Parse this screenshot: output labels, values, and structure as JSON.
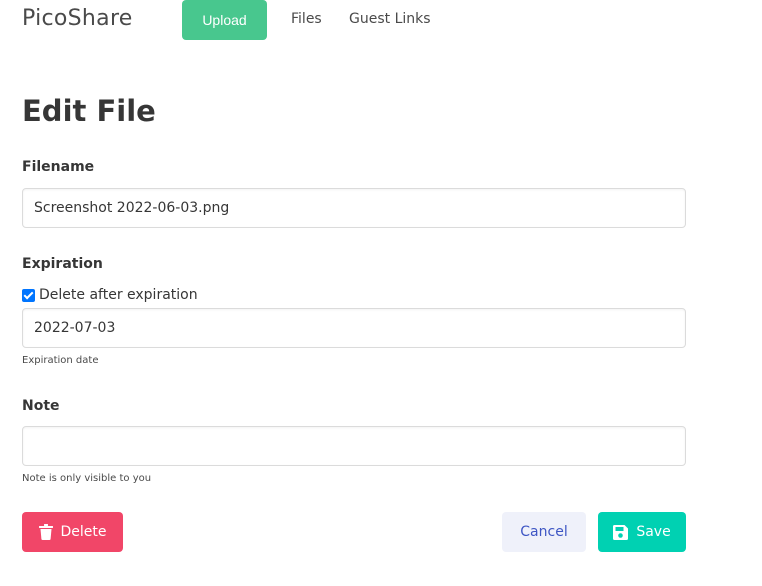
{
  "navbar": {
    "brand": "PicoShare",
    "upload_label": "Upload",
    "files_label": "Files",
    "guest_links_label": "Guest Links"
  },
  "page": {
    "title": "Edit File"
  },
  "form": {
    "filename": {
      "label": "Filename",
      "value": "Screenshot 2022-06-03.png"
    },
    "expiration": {
      "label": "Expiration",
      "checkbox_label": "Delete after expiration",
      "checked": true,
      "date_value": "2022-07-03",
      "help": "Expiration date"
    },
    "note": {
      "label": "Note",
      "value": "",
      "help": "Note is only visible to you"
    }
  },
  "actions": {
    "delete_label": "Delete",
    "cancel_label": "Cancel",
    "save_label": "Save"
  },
  "colors": {
    "upload": "#48c78e",
    "delete": "#f14668",
    "cancel_bg": "#eff1fa",
    "cancel_text": "#3e56c4",
    "save": "#00d1b2",
    "checkbox": "#0075ff"
  },
  "icons": {
    "delete": "trash-icon",
    "save": "floppy-disk-icon",
    "checkbox": "checkmark-icon"
  }
}
